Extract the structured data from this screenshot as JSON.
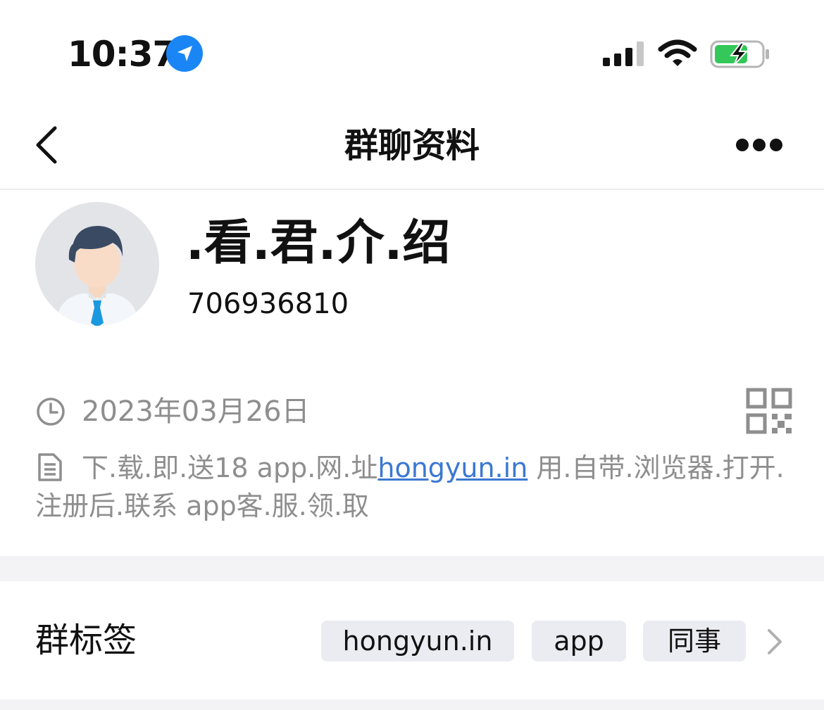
{
  "status_bar": {
    "time": "10:37",
    "icons": [
      "location-arrow-icon",
      "cellular-signal-icon",
      "wifi-icon",
      "battery-charging-icon"
    ],
    "accent_color": "#1a86f5",
    "battery_color": "#34c759"
  },
  "nav": {
    "title": "群聊资料",
    "back_icon": "chevron-left-icon",
    "more_icon": "more-dots-icon"
  },
  "group": {
    "name": ".看.君.介.绍",
    "id": "706936810",
    "avatar_icon": "person-avatar-icon"
  },
  "info": {
    "date": "2023年03月26日",
    "description_before": "下.载.即.送18 app.网.址",
    "description_link": "hongyun.in",
    "description_after": " 用.自带.浏览器.打开. 注册后.联系 app客.服.领.取",
    "link_color": "#3b78d1"
  },
  "tags": {
    "label": "群标签",
    "items": [
      "hongyun.in",
      "app",
      "同事"
    ]
  }
}
